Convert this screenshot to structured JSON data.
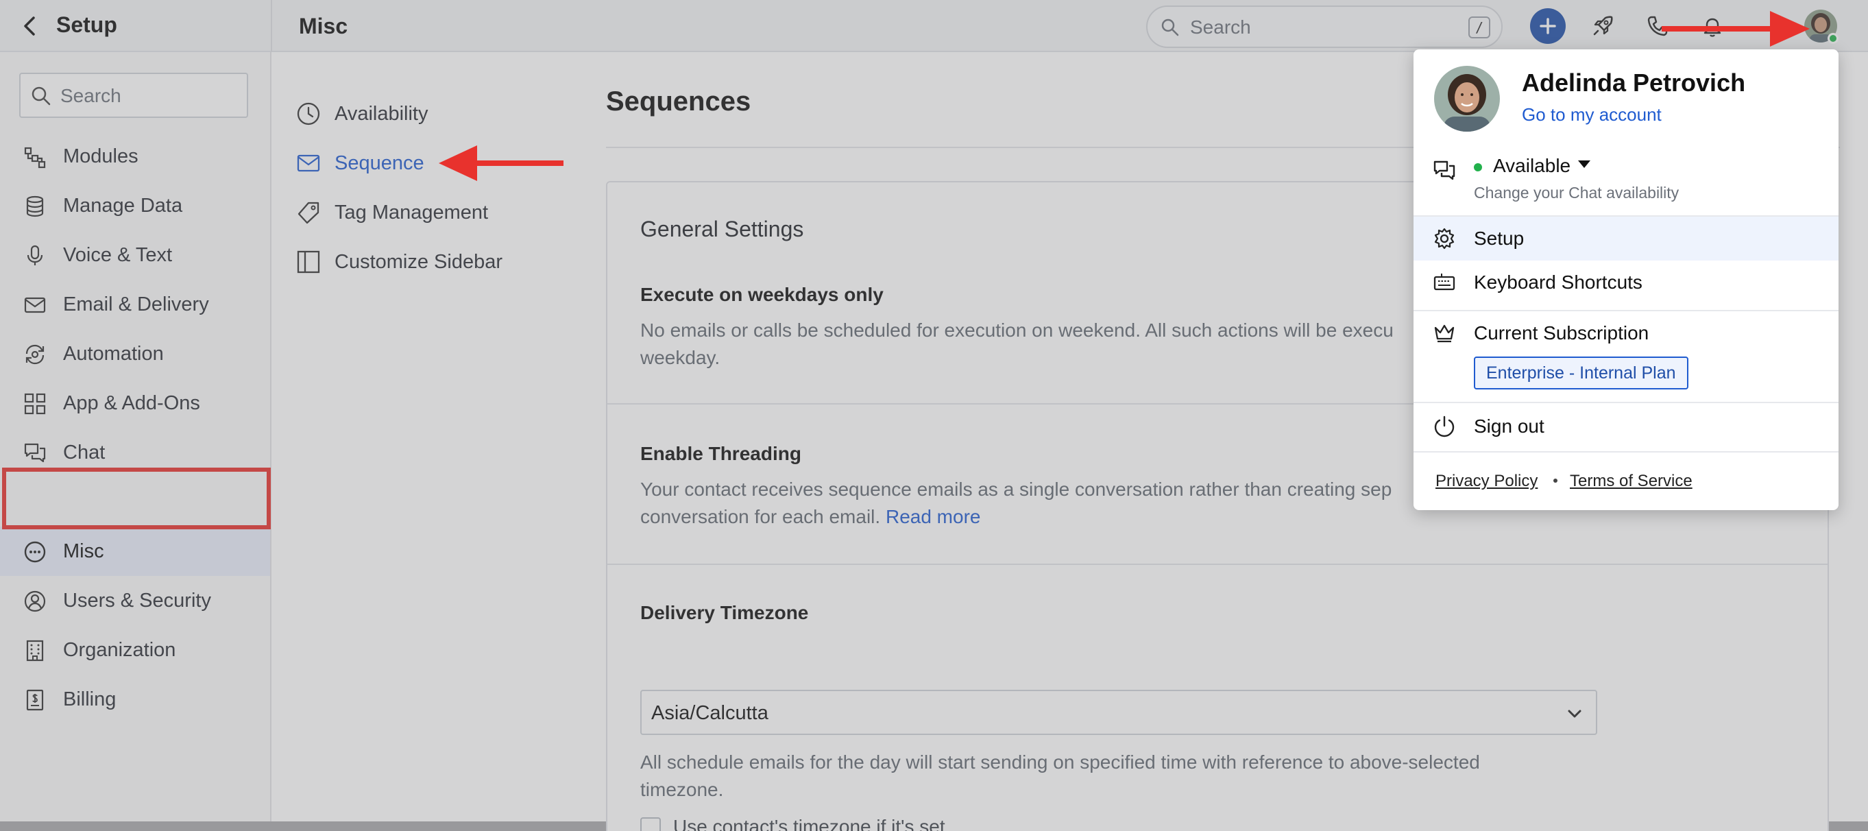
{
  "topbar": {
    "back_icon": "chevron-left-icon",
    "setup_title": "Setup",
    "page_title": "Misc",
    "search_placeholder": "Search",
    "search_shortcut": "/"
  },
  "sidebar": {
    "search_placeholder": "Search",
    "active_item": "Misc",
    "items": [
      {
        "label": "Modules",
        "icon": "modules-icon"
      },
      {
        "label": "Manage Data",
        "icon": "database-icon"
      },
      {
        "label": "Voice & Text",
        "icon": "microphone-icon"
      },
      {
        "label": "Email & Delivery",
        "icon": "envelope-icon"
      },
      {
        "label": "Automation",
        "icon": "automation-icon"
      },
      {
        "label": "App & Add-Ons",
        "icon": "grid-icon"
      },
      {
        "label": "Chat",
        "icon": "chat-icon"
      },
      {
        "label": "Misc",
        "icon": "more-circle-icon"
      },
      {
        "label": "Users & Security",
        "icon": "user-circle-icon"
      },
      {
        "label": "Organization",
        "icon": "building-icon"
      },
      {
        "label": "Billing",
        "icon": "billing-icon"
      }
    ]
  },
  "subnav": {
    "active_item": "Sequence",
    "items": [
      {
        "label": "Availability",
        "icon": "clock-icon"
      },
      {
        "label": "Sequence",
        "icon": "envelope-icon"
      },
      {
        "label": "Tag Management",
        "icon": "tag-icon"
      },
      {
        "label": "Customize Sidebar",
        "icon": "sidebar-layout-icon"
      }
    ]
  },
  "main": {
    "title": "Sequences",
    "card_title": "General Settings",
    "sections": {
      "weekdays": {
        "title": "Execute on weekdays only",
        "description": "No emails or calls be scheduled for execution on weekend. All such actions will be execu",
        "description_cont": "weekday."
      },
      "threading": {
        "title": "Enable Threading",
        "description": "Your contact receives sequence emails as a single conversation rather than creating sep",
        "description_cont": "conversation for each email.",
        "link": "Read more"
      },
      "timezone": {
        "title": "Delivery Timezone",
        "selected": "Asia/Calcutta",
        "description": "All schedule emails for the day will start sending on specified time with reference to above-selected",
        "description_cont": "timezone.",
        "checkbox_label": "Use contact's timezone if it's set",
        "checkbox_checked": false
      }
    }
  },
  "profile_menu": {
    "name": "Adelinda Petrovich",
    "account_link": "Go to my account",
    "status": "Available",
    "status_color": "#22b14c",
    "status_hint": "Change your Chat availability",
    "items": {
      "setup": "Setup",
      "shortcuts": "Keyboard Shortcuts",
      "subscription": "Current Subscription",
      "plan": "Enterprise - Internal Plan",
      "signout": "Sign out"
    },
    "footer": {
      "privacy": "Privacy Policy",
      "terms": "Terms of Service"
    }
  },
  "colors": {
    "accent": "#1f5bd0",
    "annotation": "#e8322d",
    "primary_button": "#1e4ea8"
  }
}
